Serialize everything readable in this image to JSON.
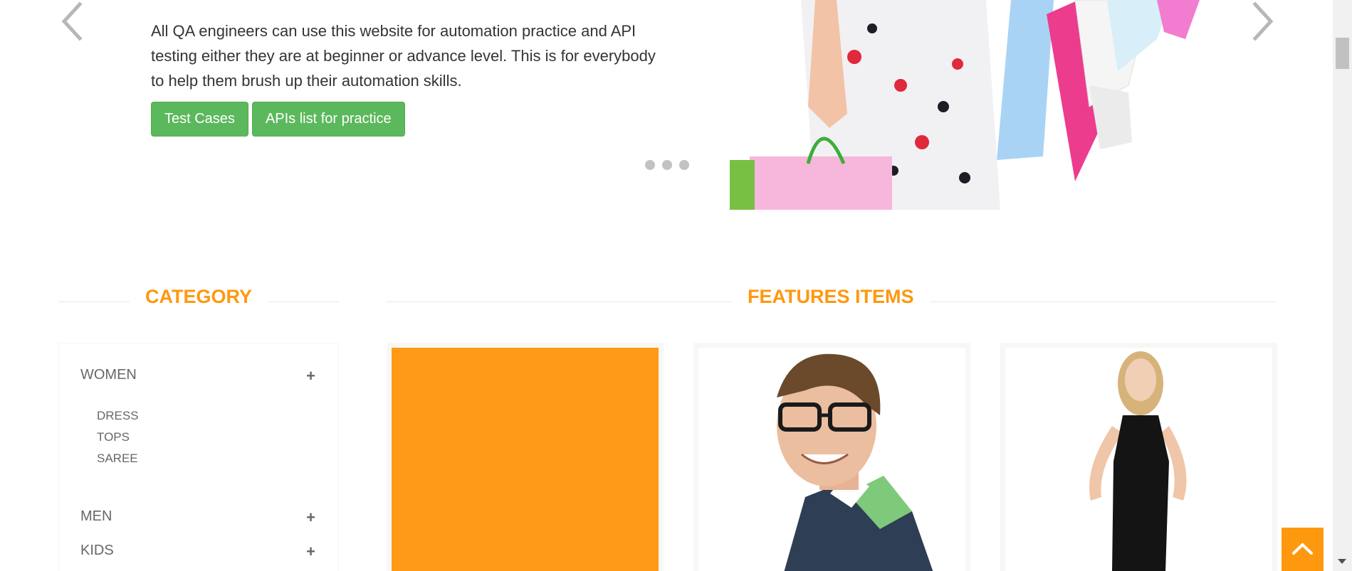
{
  "slider": {
    "description": "All QA engineers can use this website for automation practice and API testing either they are at beginner or advance level. This is for everybody to help them brush up their automation skills.",
    "buttons": {
      "test_cases": "Test Cases",
      "apis_list": "APIs list for practice"
    },
    "dots_count": 3
  },
  "category": {
    "title": "Category",
    "items": [
      {
        "label": "WOMEN",
        "sub": [
          "Dress",
          "Tops",
          "Saree"
        ]
      },
      {
        "label": "MEN"
      },
      {
        "label": "KIDS"
      }
    ]
  },
  "features": {
    "title": "Features Items"
  },
  "colors": {
    "accent": "#fe980f",
    "button_green": "#5cb85c",
    "text": "#363432",
    "category_text": "#696763"
  },
  "icons": {
    "prev": "chevron-left-icon",
    "next": "chevron-right-icon",
    "plus": "plus-icon",
    "scroll_up": "chevron-up-icon"
  }
}
